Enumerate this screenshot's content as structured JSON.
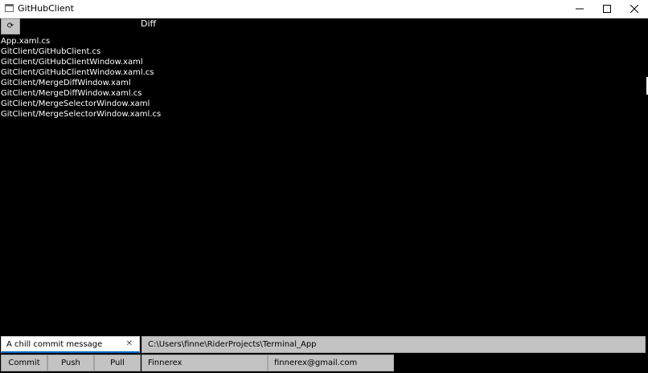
{
  "window": {
    "title": "GitHubClient"
  },
  "toolbar": {
    "refresh_icon": "⟳"
  },
  "diff": {
    "label": "Diff"
  },
  "files": [
    "App.xaml.cs",
    "GitClient/GitHubClient.cs",
    "GitClient/GitHubClientWindow.xaml",
    "GitClient/GitHubClientWindow.xaml.cs",
    "GitClient/MergeDiffWindow.xaml",
    "GitClient/MergeDiffWindow.xaml.cs",
    "GitClient/MergeSelectorWindow.xaml",
    "GitClient/MergeSelectorWindow.xaml.cs"
  ],
  "commit": {
    "message": "A chill commit message",
    "clear_icon": "✕"
  },
  "repo": {
    "path": "C:\\Users\\finne\\RiderProjects\\Terminal_App"
  },
  "actions": {
    "commit_label": "Commit",
    "push_label": "Push",
    "pull_label": "Pull"
  },
  "user": {
    "name": "Finnerex",
    "email": "finnerex@gmail.com"
  },
  "colors": {
    "background": "#000000",
    "field": "#c3c3c3",
    "focus_accent": "#0067c0"
  }
}
